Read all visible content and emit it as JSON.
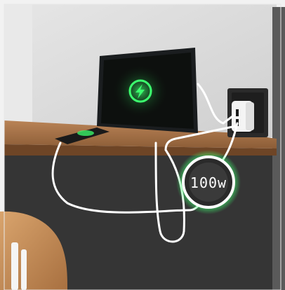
{
  "product": {
    "wattage_display": "100w"
  },
  "colors": {
    "glow": "#3cff6e",
    "wall": "#dcdcdc",
    "shelf": "#a8744a",
    "felt": "#3a3a3a",
    "cable": "#ffffff",
    "charger": "#f4f4f4"
  },
  "icons": {
    "tablet_screen": "lightning-bolt-icon",
    "phone_screen": "wireless-charge-icon"
  }
}
